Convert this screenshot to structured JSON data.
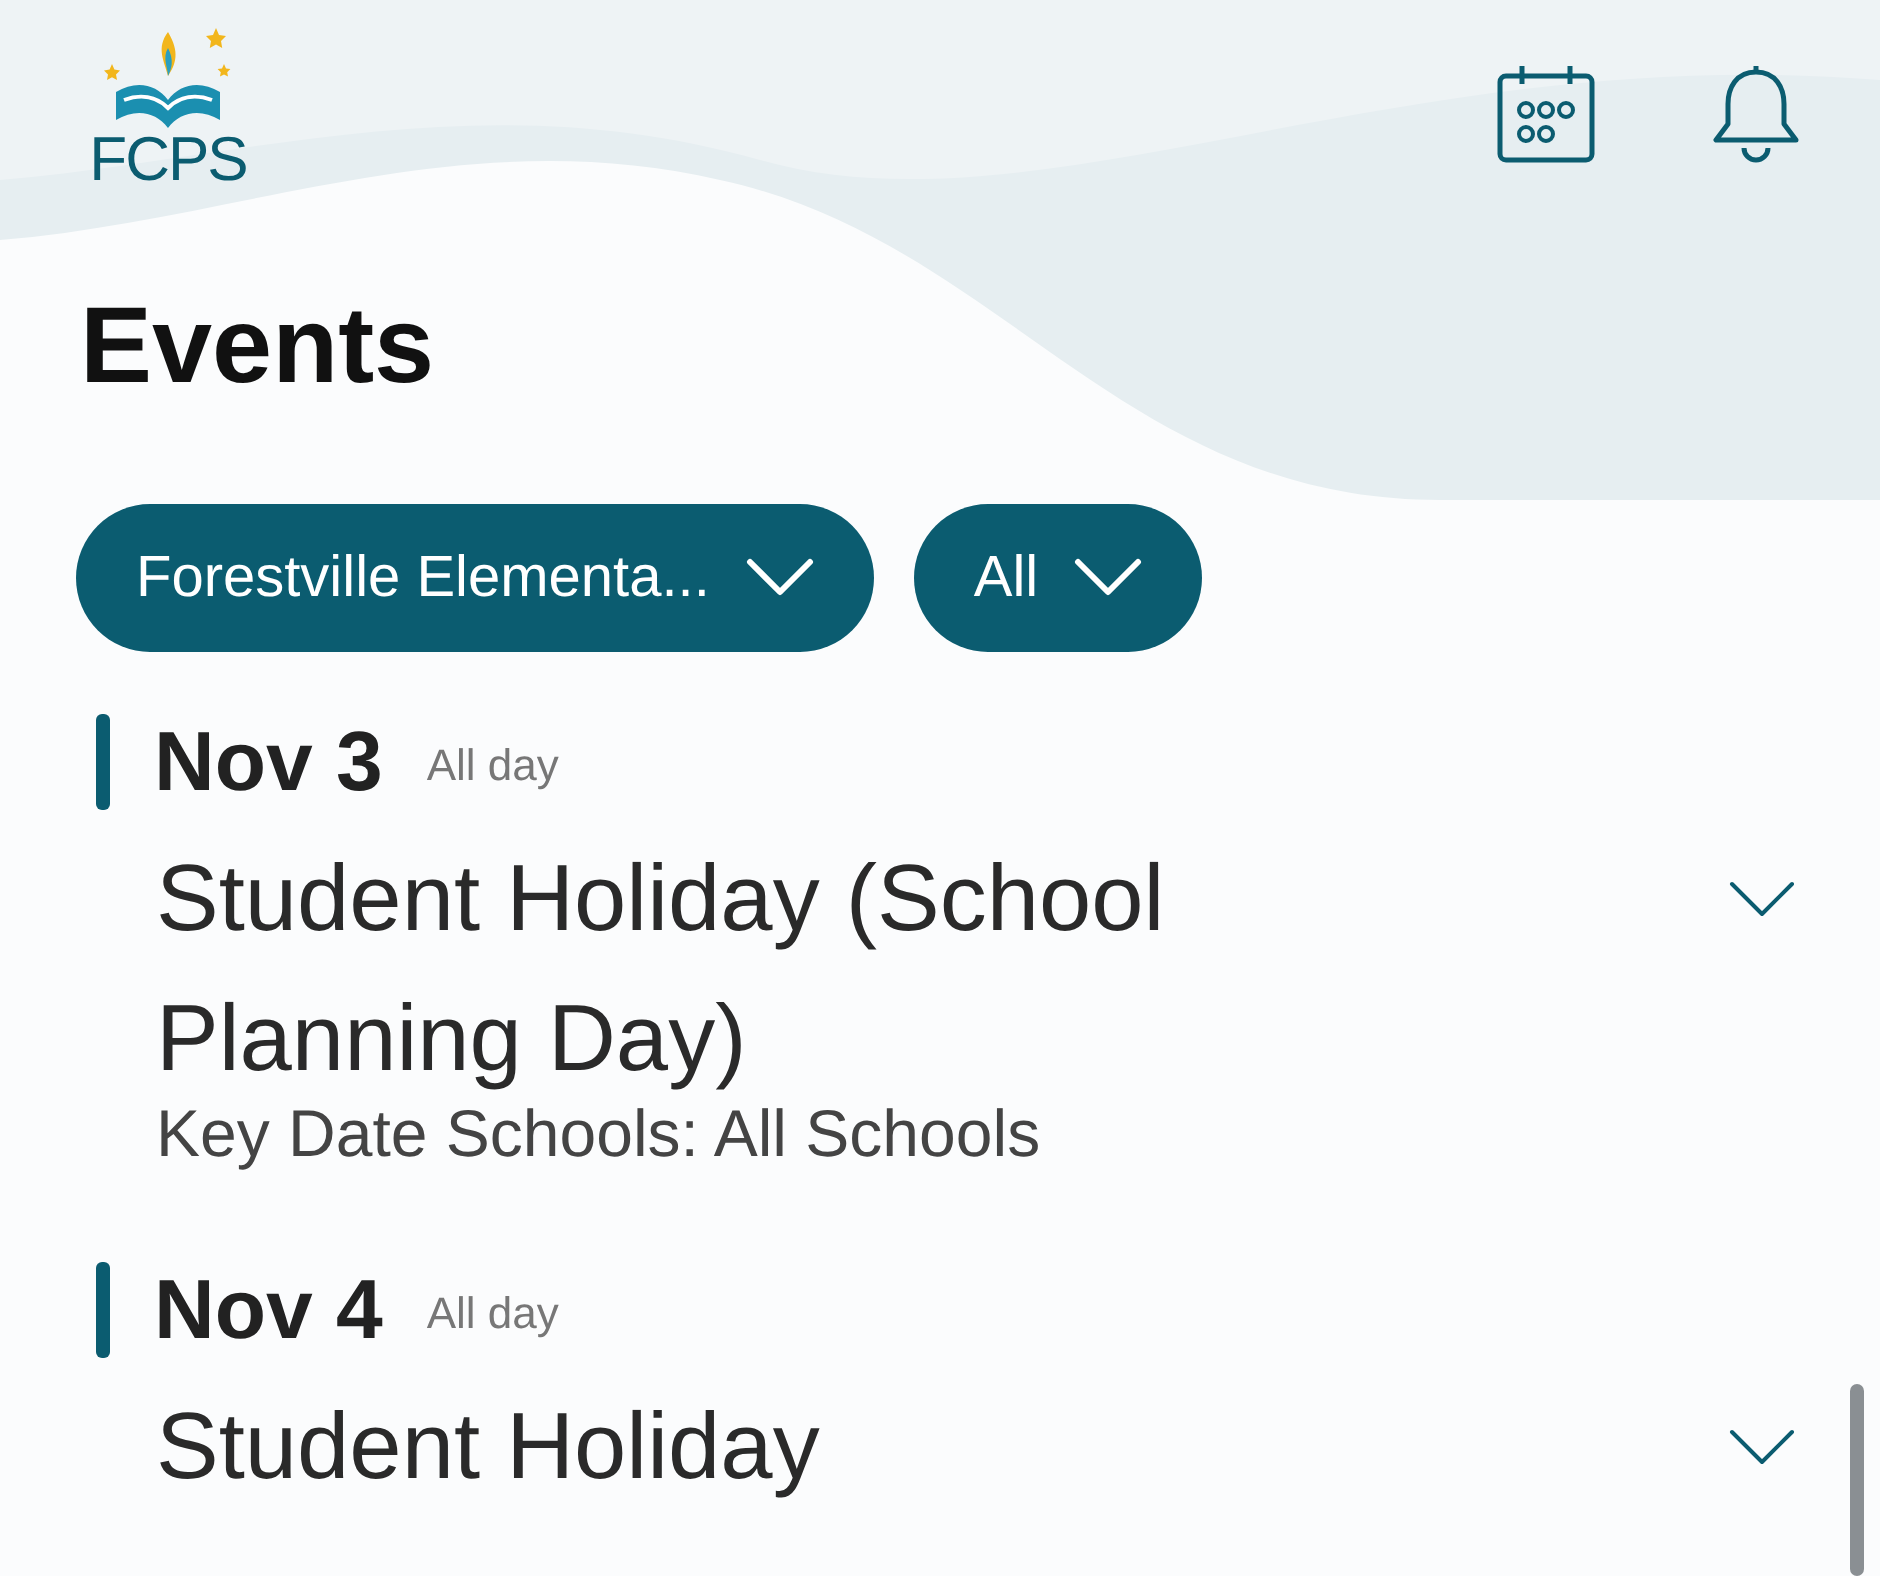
{
  "header": {
    "logo_text": "FCPS"
  },
  "title": "Events",
  "filters": [
    {
      "label": "Forestville Elementa..."
    },
    {
      "label": "All"
    }
  ],
  "events": [
    {
      "date": "Nov 3",
      "time": "All day",
      "title": "Student Holiday (School Planning Day)",
      "subtitle": "Key Date Schools: All Schools",
      "expanded": false
    },
    {
      "date": "Nov 4",
      "time": "All day",
      "title": "Student Holiday",
      "expanded": false
    }
  ]
}
